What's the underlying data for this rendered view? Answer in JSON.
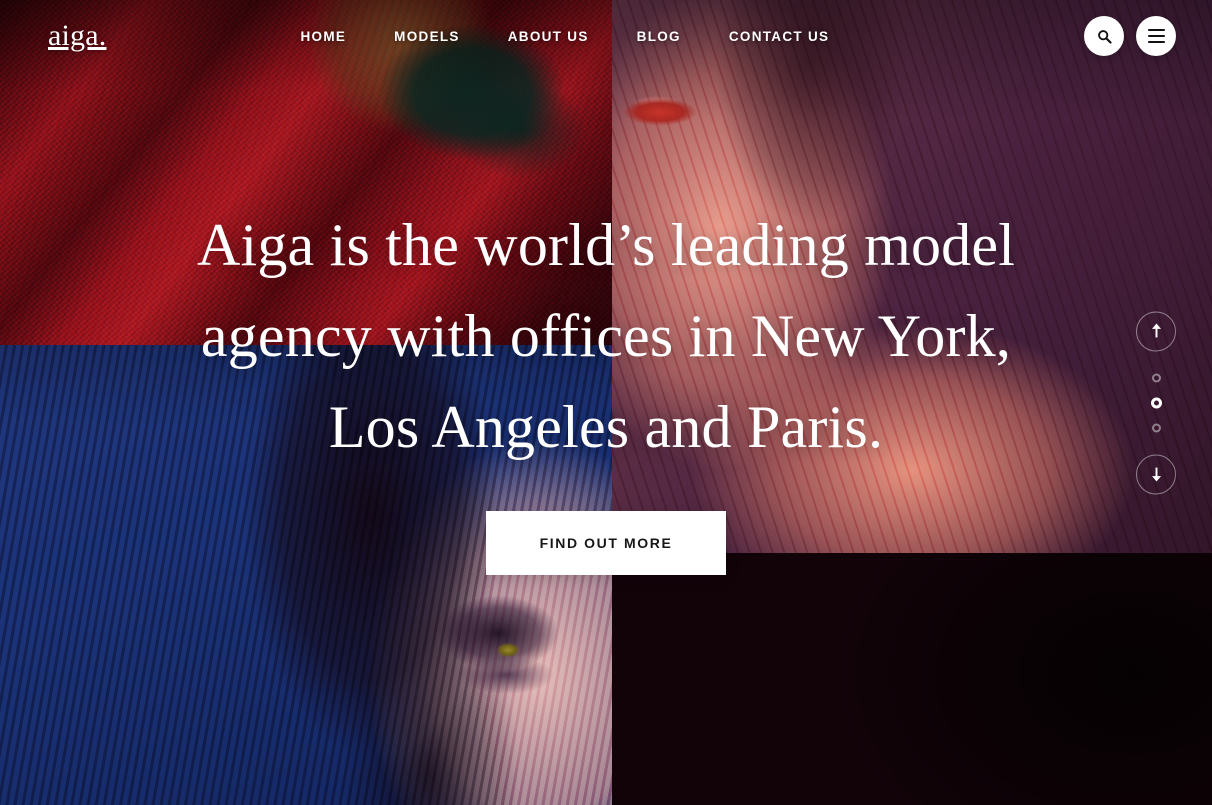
{
  "header": {
    "logo": "aiga.",
    "nav": [
      {
        "label": "HOME",
        "active": true
      },
      {
        "label": "MODELS",
        "active": false
      },
      {
        "label": "ABOUT US",
        "active": false
      },
      {
        "label": "BLOG",
        "active": false
      },
      {
        "label": "CONTACT US",
        "active": false
      }
    ],
    "actions": [
      {
        "name": "search-icon",
        "label": "Search"
      },
      {
        "name": "hamburger-icon",
        "label": "Menu"
      }
    ]
  },
  "hero": {
    "headline_lines": [
      "Aiga is the world’s leading model",
      "agency with offices in New York,",
      "Los Angeles and Paris."
    ],
    "cta_label": "FIND OUT MORE"
  },
  "rail": {
    "up_icon": "arrow-up-icon",
    "down_icon": "arrow-down-icon",
    "slides": [
      {
        "index": 1,
        "active": false
      },
      {
        "index": 2,
        "active": true
      },
      {
        "index": 3,
        "active": false
      }
    ]
  },
  "colors": {
    "navy": "#1b3378",
    "plum": "#4a2240",
    "crimson": "#9c1420",
    "white": "#ffffff",
    "text_dark": "#17171a"
  }
}
